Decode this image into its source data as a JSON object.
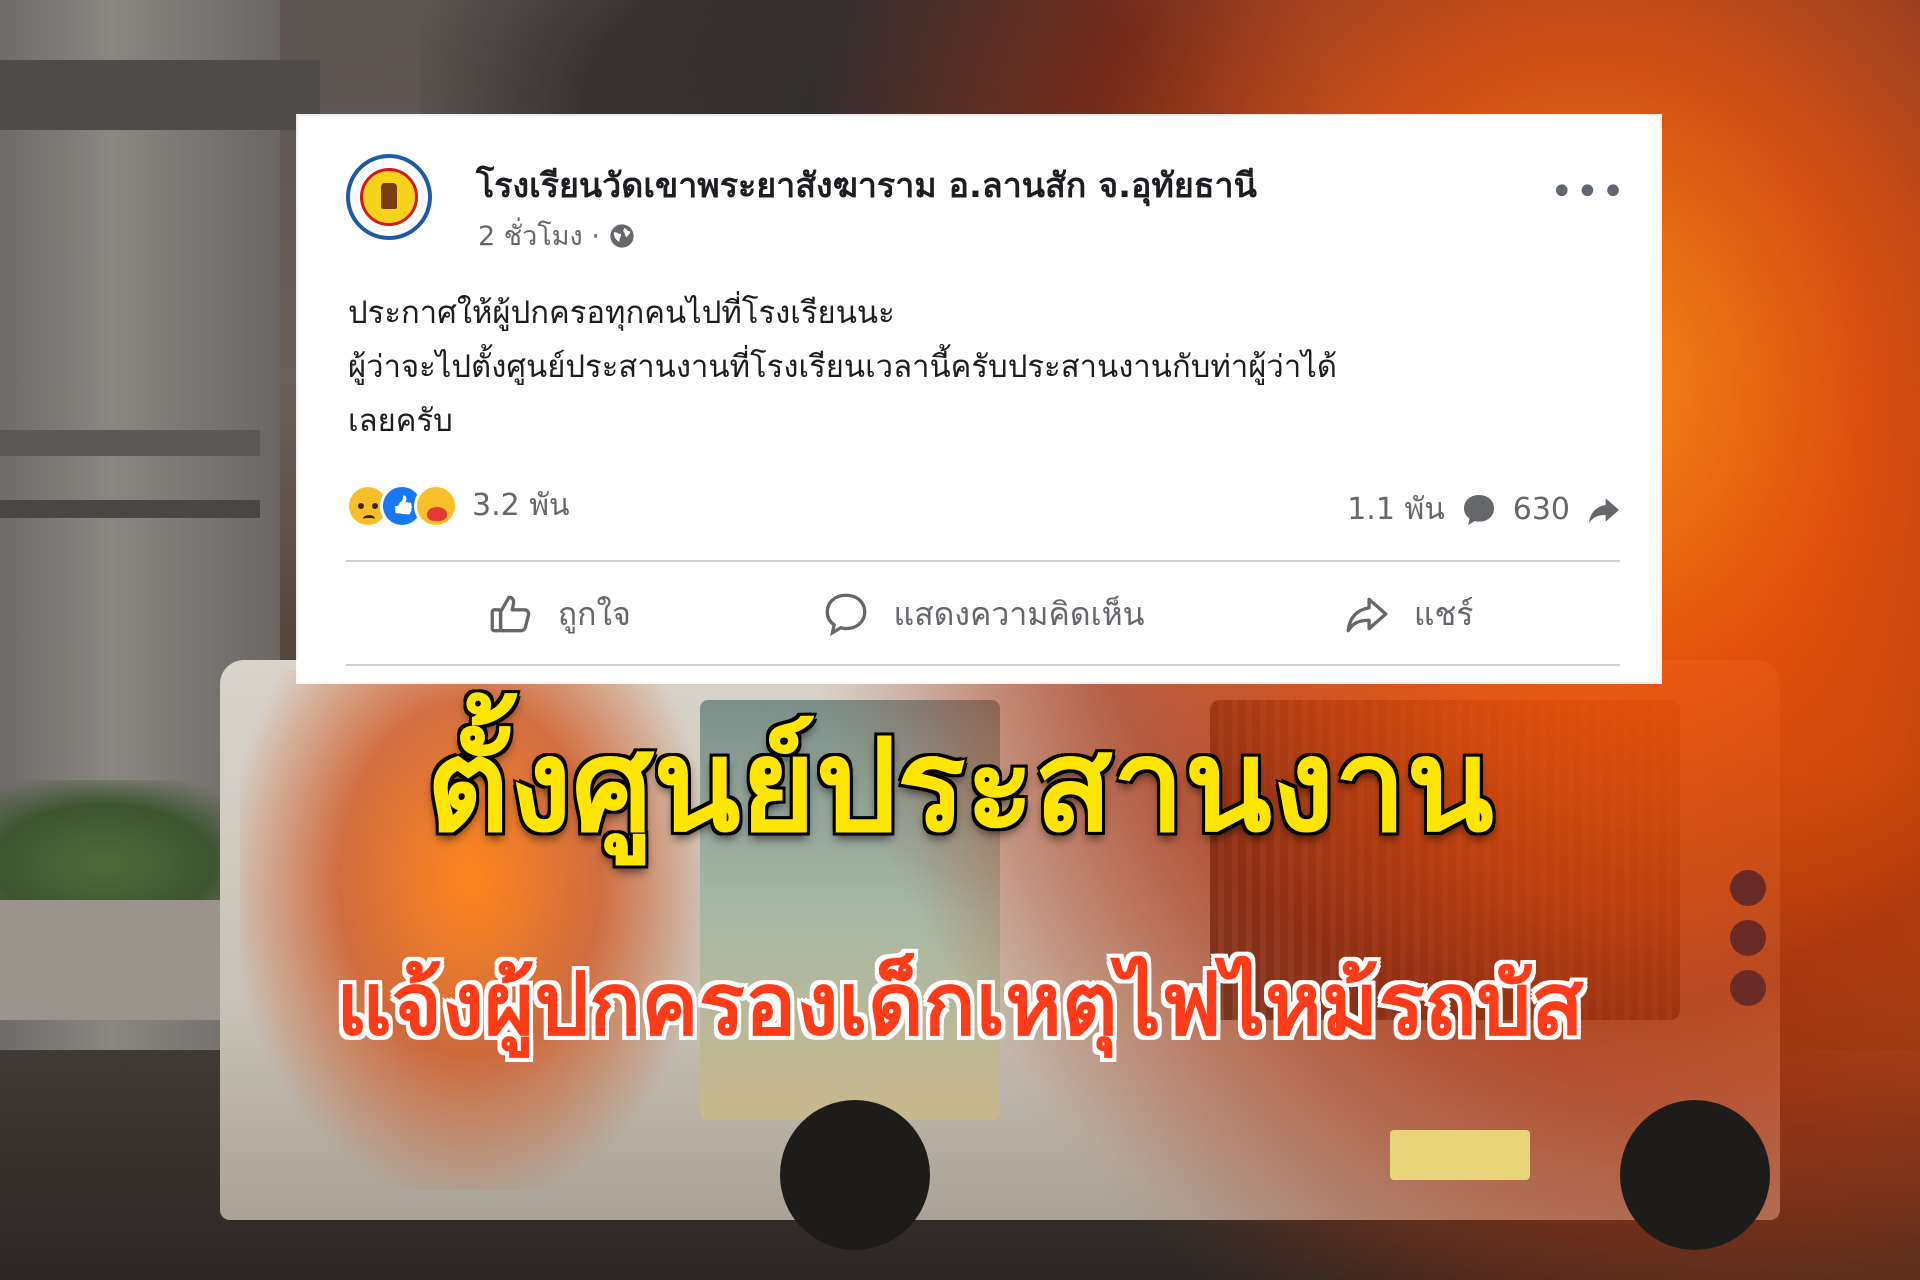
{
  "post": {
    "page_name": "โรงเรียนวัดเขาพระยาสังฆาราม อ.ลานสัก จ.อุทัยธานี",
    "time_label": "2 ชั่วโมง ·",
    "text_lines": [
      "ประกาศให้ผู้ปกครอทุกคนไปที่โรงเรียนนะ",
      "ผู้ว่าจะไปตั้งศูนย์ประสานงานที่โรงเรียนเวลานี้ครับประสานงานกับท่าผู้ว่าได้",
      "เลยครับ"
    ],
    "reaction_count": "3.2 พัน",
    "comment_count": "1.1 พัน",
    "share_count": "630",
    "actions": {
      "like": "ถูกใจ",
      "comment": "แสดงความคิดเห็น",
      "share": "แชร์"
    }
  },
  "headline": {
    "line1": "ตั้งศูนย์ประสานงาน",
    "line2": "แจ้งผู้ปกครองเด็กเหตุไฟไหม้รถบัส"
  },
  "icons": {
    "reactions": [
      "sad-reaction-icon",
      "like-reaction-icon",
      "care-reaction-icon"
    ],
    "meta": "globe-icon",
    "menu": "more-icon",
    "comment": "comment-icon",
    "share": "share-icon"
  },
  "colors": {
    "headline1": "#ffe600",
    "headline2": "#ff3c1a",
    "facebook_blue": "#1877f2",
    "muted_text": "#65676b"
  }
}
